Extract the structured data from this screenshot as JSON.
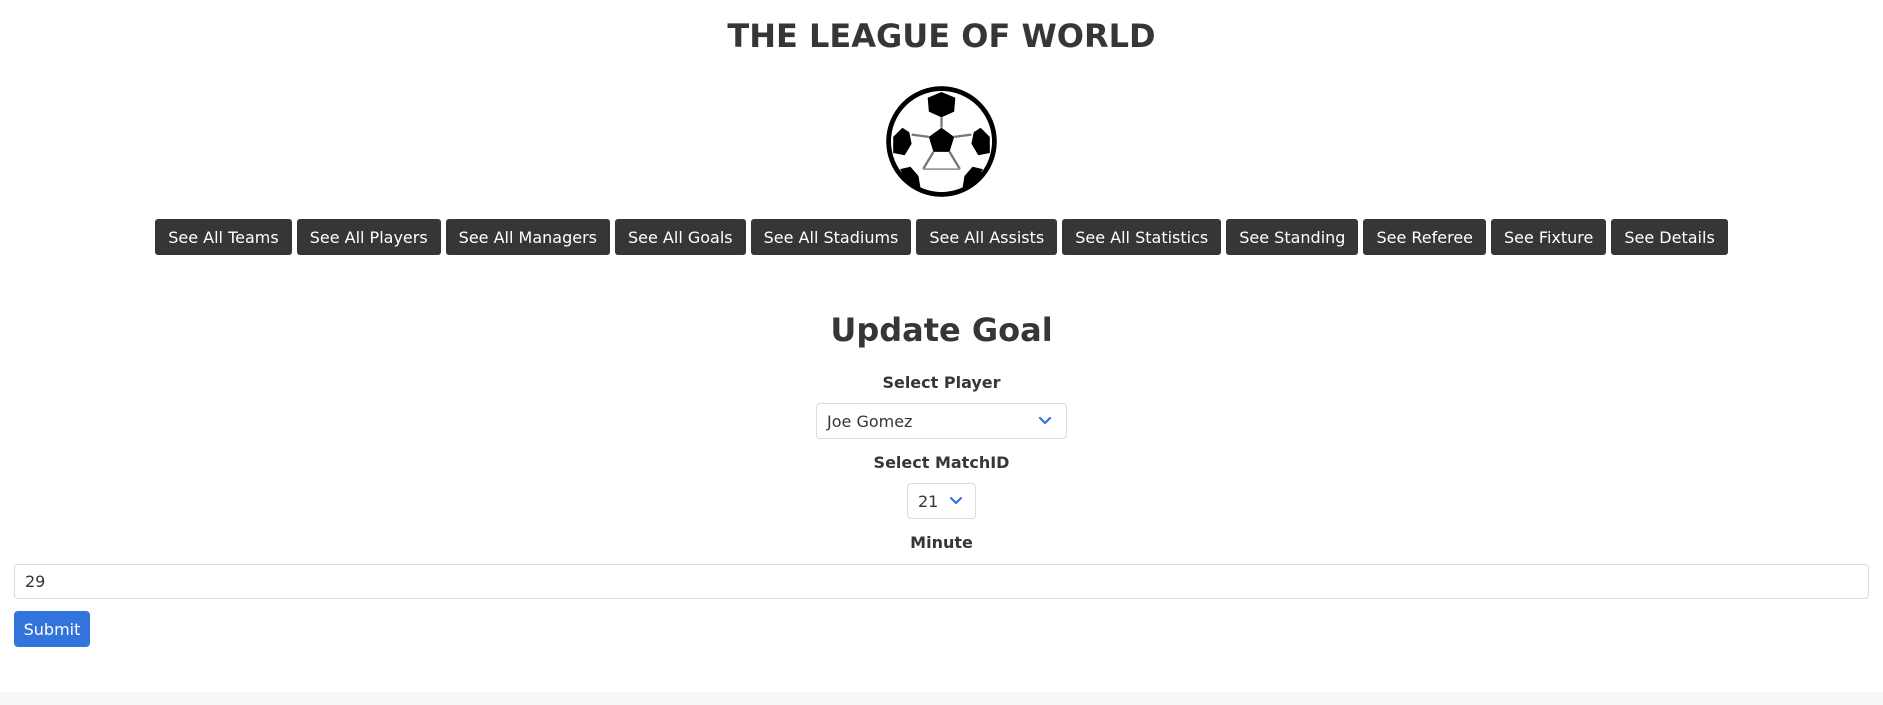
{
  "header": {
    "title": "THE LEAGUE OF WORLD"
  },
  "nav": {
    "items": [
      "See All Teams",
      "See All Players",
      "See All Managers",
      "See All Goals",
      "See All Stadiums",
      "See All Assists",
      "See All Statistics",
      "See Standing",
      "See Referee",
      "See Fixture",
      "See Details"
    ]
  },
  "form": {
    "title": "Update Goal",
    "player": {
      "label": "Select Player",
      "value": "Joe Gomez"
    },
    "match": {
      "label": "Select MatchID",
      "value": "21"
    },
    "minute": {
      "label": "Minute",
      "value": "29"
    },
    "submit_label": "Submit"
  },
  "colors": {
    "nav_button": "#363636",
    "submit_button": "#3273dc",
    "chevron": "#3273dc"
  },
  "icons": {
    "logo": "soccer-ball-icon",
    "select_arrow": "chevron-down-icon"
  }
}
